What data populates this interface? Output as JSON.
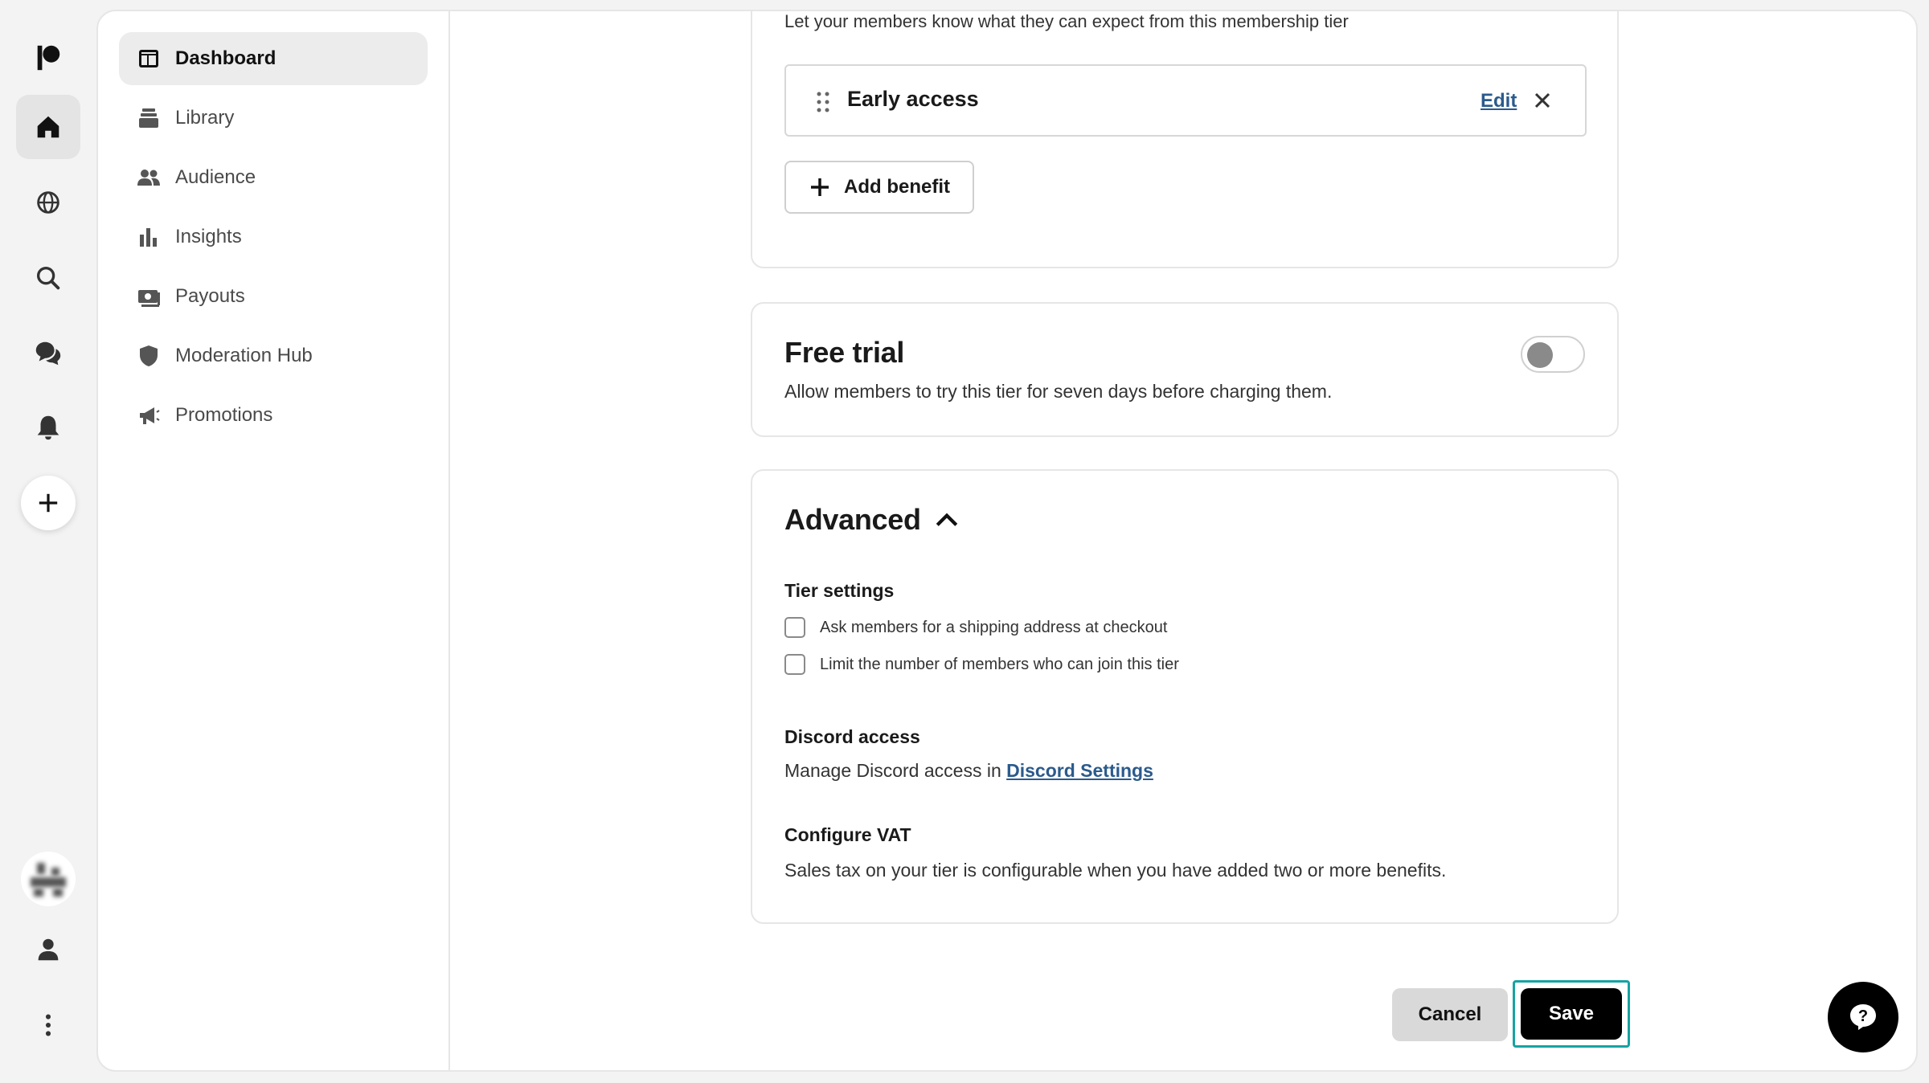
{
  "sidebar": {
    "items": [
      {
        "label": "Dashboard",
        "icon": "dashboard-icon"
      },
      {
        "label": "Library",
        "icon": "library-icon"
      },
      {
        "label": "Audience",
        "icon": "audience-icon"
      },
      {
        "label": "Insights",
        "icon": "insights-icon"
      },
      {
        "label": "Payouts",
        "icon": "payouts-icon"
      },
      {
        "label": "Moderation Hub",
        "icon": "shield-icon"
      },
      {
        "label": "Promotions",
        "icon": "megaphone-icon"
      }
    ]
  },
  "rail": {
    "icons": [
      "patreon-logo-icon",
      "home-icon",
      "globe-icon",
      "search-icon",
      "chat-icon",
      "bell-icon",
      "plus-icon",
      "avatar",
      "user-icon",
      "more-vertical-icon"
    ]
  },
  "benefits": {
    "intro": "Let your members know what they can expect from this membership tier",
    "item_title": "Early access",
    "edit_label": "Edit",
    "add_label": "Add benefit"
  },
  "free_trial": {
    "title": "Free trial",
    "description": "Allow members to try this tier for seven days before charging them.",
    "enabled": false
  },
  "advanced": {
    "title": "Advanced",
    "tier_settings_label": "Tier settings",
    "option_shipping": "Ask members for a shipping address at checkout",
    "option_limit": "Limit the number of members who can join this tier",
    "discord_label": "Discord access",
    "discord_text": "Manage Discord access in ",
    "discord_link": "Discord Settings",
    "vat_label": "Configure VAT",
    "vat_text": "Sales tax on your tier is configurable when you have added two or more benefits."
  },
  "actions": {
    "cancel_label": "Cancel",
    "save_label": "Save"
  },
  "colors": {
    "link": "#2b5a8c",
    "save_focus": "#16a3a3"
  }
}
